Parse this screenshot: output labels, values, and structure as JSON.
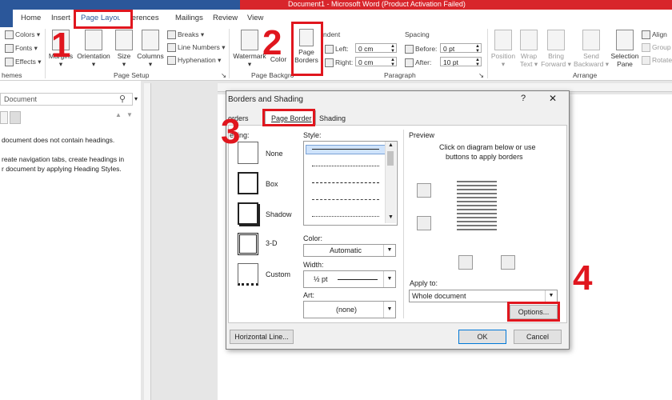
{
  "titlebar": {
    "title": "Document1 - Microsoft Word (Product Activation Failed)"
  },
  "tabs": {
    "home": "Home",
    "insert": "Insert",
    "page_layout": "Page Layout",
    "references": "References",
    "mailings": "Mailings",
    "review": "Review",
    "view": "View"
  },
  "ribbon": {
    "themes": {
      "colors": "Colors",
      "fonts": "Fonts",
      "effects": "Effects",
      "group": "hemes"
    },
    "page_setup": {
      "margins": "Margins",
      "orientation": "Orientation",
      "size": "Size",
      "columns": "Columns",
      "breaks": "Breaks",
      "line_numbers": "Line Numbers",
      "hyphenation": "Hyphenation",
      "group": "Page Setup"
    },
    "page_background": {
      "watermark": "Watermark",
      "page_color": "Color",
      "page_borders_1": "Page",
      "page_borders_2": "Borders",
      "group": "Page Backgro"
    },
    "paragraph": {
      "indent": "ndent",
      "left": "Left:",
      "left_val": "0 cm",
      "right": "Right:",
      "right_val": "0 cm",
      "spacing": "Spacing",
      "before": "Before:",
      "before_val": "0 pt",
      "after": "After:",
      "after_val": "10 pt",
      "group": "Paragraph"
    },
    "arrange": {
      "position": "Position",
      "wrap_1": "Wrap",
      "wrap_2": "Text",
      "bring_1": "Bring",
      "bring_2": "Forward",
      "send_1": "Send",
      "send_2": "Backward",
      "selection_1": "Selection",
      "selection_2": "Pane",
      "align": "Align",
      "group_btn": "Group",
      "rotate": "Rotate",
      "group": "Arrange"
    }
  },
  "navpane": {
    "search_placeholder": "Document",
    "msg1": "document does not contain headings.",
    "msg2a": "reate navigation tabs, create headings in",
    "msg2b": "r document by applying Heading Styles."
  },
  "dialog": {
    "title": "Borders and Shading",
    "help": "?",
    "close": "✕",
    "tabs": {
      "borders": "orders",
      "page_border": "Page Border",
      "shading": "Shading"
    },
    "setting": {
      "label": "etting:",
      "none": "None",
      "box": "Box",
      "shadow": "Shadow",
      "threed": "3-D",
      "custom": "Custom"
    },
    "style_label": "Style:",
    "color_label": "Color:",
    "color_value": "Automatic",
    "width_label": "Width:",
    "width_value": "½ pt",
    "art_label": "Art:",
    "art_value": "(none)",
    "preview_label": "Preview",
    "preview_hint_1": "Click on diagram below or use",
    "preview_hint_2": "buttons to apply borders",
    "apply_to_label": "Apply to:",
    "apply_to_value": "Whole document",
    "options": "Options...",
    "horizontal_line": "Horizontal Line...",
    "ok": "OK",
    "cancel": "Cancel"
  },
  "steps": {
    "s1": "1",
    "s2": "2",
    "s3": "3",
    "s4": "4"
  },
  "colors": {
    "accent": "#2b579a",
    "highlight": "#e0161e"
  }
}
